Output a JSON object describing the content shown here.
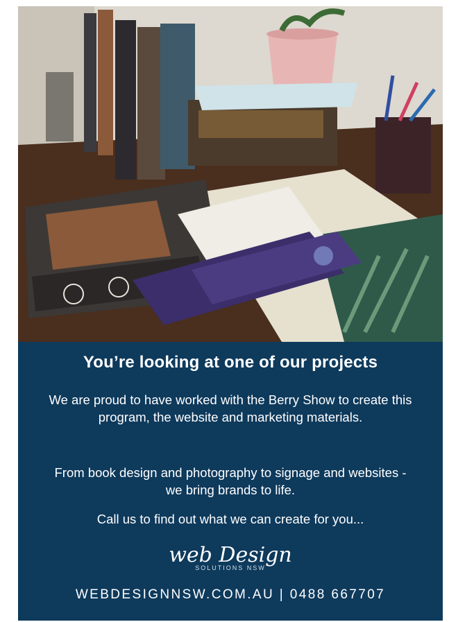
{
  "ad": {
    "headline": "You’re looking at one of our projects",
    "paragraph1": "We are proud to have worked with the Berry Show to create this program, the website and marketing materials.",
    "paragraph2": "From book design and photography to signage and websites - we bring brands to life.",
    "paragraph3": "Call us to find out what we can create for you...",
    "logo_script": "web Design",
    "logo_sub": "SOLUTIONS NSW",
    "contact": "WEBDESIGNNSW.COM.AU | 0488 667707",
    "colors": {
      "panel": "#0e3a5c",
      "text": "#ffffff"
    }
  }
}
